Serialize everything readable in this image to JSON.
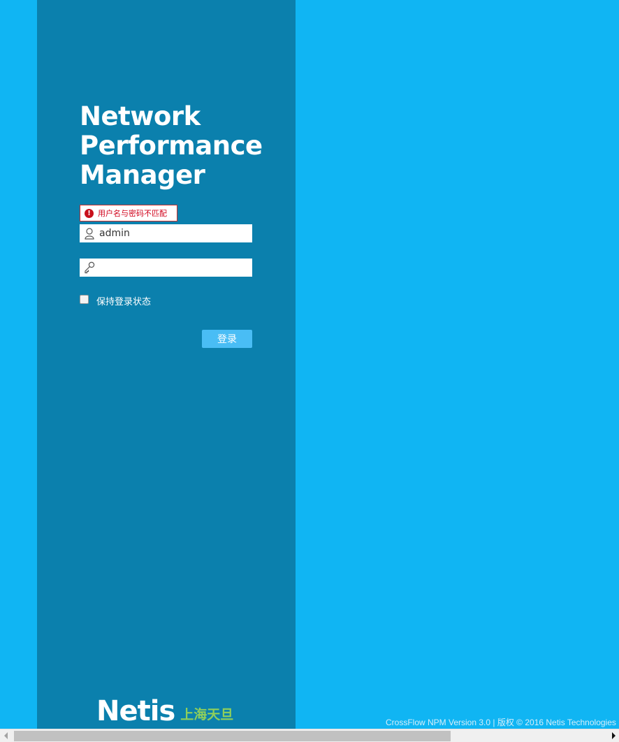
{
  "app": {
    "title_lines": [
      "Network",
      "Performance",
      "Manager"
    ]
  },
  "login": {
    "error_message": "用户名与密码不匹配",
    "error_icon": "exclamation-circle-icon",
    "username": {
      "value": "admin",
      "icon": "user-icon"
    },
    "password": {
      "value": "",
      "icon": "key-icon"
    },
    "remember_label": "保持登录状态",
    "remember_checked": false,
    "submit_label": "登录"
  },
  "branding": {
    "logo_text": "Netis",
    "logo_cn": "上海天旦"
  },
  "footer": {
    "text": "CrossFlow NPM Version 3.0 | 版权 © 2016 Netis Technologies"
  },
  "colors": {
    "background": "#10b5f3",
    "panel": "#0b80ad",
    "button": "#49bdf5",
    "error": "#c8101c",
    "logo_cn": "#8fcf5b"
  }
}
